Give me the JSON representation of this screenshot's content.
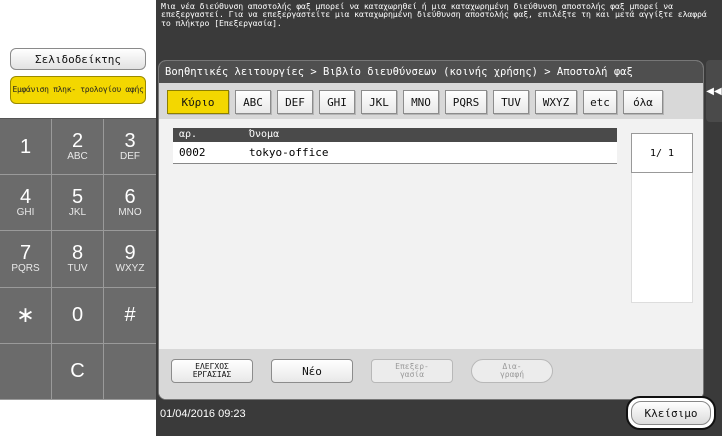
{
  "message": "Μια νέα διεύθυνση αποστολής φαξ μπορεί να καταχωρηθεί ή μια καταχωρημένη διεύθυνση αποστολής φαξ μπορεί να επεξεργαστεί. Για να επεξεργαστείτε μια καταχωρημένη διεύθυνση αποστολής φαξ, επιλέξτε τη και μετά αγγίξτε ελαφρά το πλήκτρο [Επεξεργασία].",
  "left_panel": {
    "bookmark_label": "Σελιδοδείκτης",
    "counter_label": "Εμφάνιση πληκ- τρολογίου αφής"
  },
  "keypad": [
    {
      "num": "1",
      "sub": ""
    },
    {
      "num": "2",
      "sub": "ABC"
    },
    {
      "num": "3",
      "sub": "DEF"
    },
    {
      "num": "4",
      "sub": "GHI"
    },
    {
      "num": "5",
      "sub": "JKL"
    },
    {
      "num": "6",
      "sub": "MNO"
    },
    {
      "num": "7",
      "sub": "PQRS"
    },
    {
      "num": "8",
      "sub": "TUV"
    },
    {
      "num": "9",
      "sub": "WXYZ"
    },
    {
      "num": "∗",
      "sub": ""
    },
    {
      "num": "0",
      "sub": ""
    },
    {
      "num": "#",
      "sub": ""
    },
    {
      "num": "",
      "sub": ""
    },
    {
      "num": "C",
      "sub": ""
    },
    {
      "num": "",
      "sub": ""
    }
  ],
  "breadcrumb": "Βοηθητικές λειτουργίες > Βιβλίο διευθύνσεων (κοινής χρήσης) > Αποστολή φαξ",
  "tabs": [
    "Κύριο",
    "ABC",
    "DEF",
    "GHI",
    "JKL",
    "MNO",
    "PQRS",
    "TUV",
    "WXYZ",
    "etc",
    "όλα"
  ],
  "active_tab": "Κύριο",
  "table": {
    "headers": {
      "no": "αρ.",
      "name": "Όνομα"
    },
    "rows": [
      {
        "no": "0002",
        "name": "tokyo-office"
      }
    ]
  },
  "page_indicator": "1/ 1",
  "actions": {
    "check_job": "ΕΛΕΓΧΟΣ ΕΡΓΑΣΙΑΣ",
    "new": "Νέο",
    "edit": "Επεξερ- γασία",
    "delete": "Δια- γραφή"
  },
  "datetime": "01/04/2016   09:23",
  "close_label": "Κλείσιμο",
  "colors": {
    "accent": "#f3d700",
    "panel_dark": "#3a3a3a",
    "keypad": "#6b6b6b"
  }
}
